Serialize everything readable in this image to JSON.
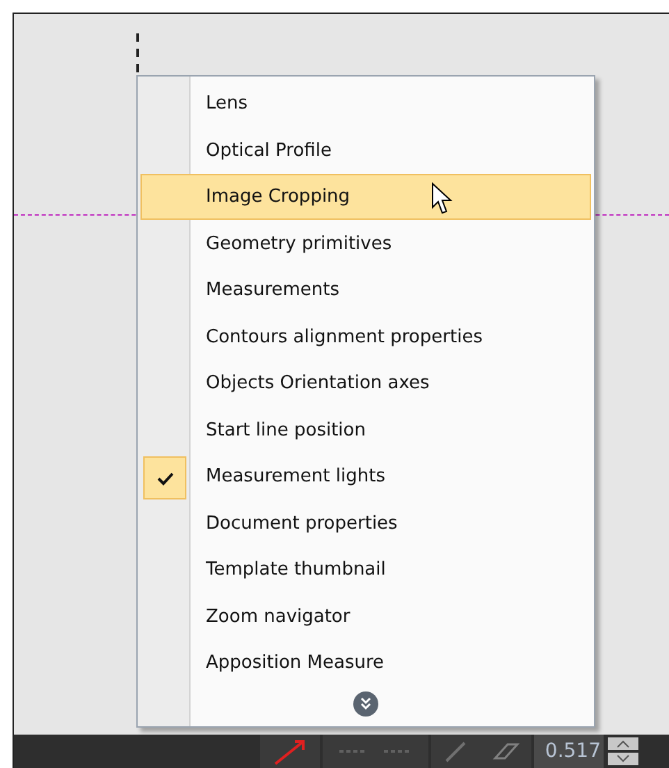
{
  "menu": {
    "items": [
      {
        "label": "Lens",
        "checked": false,
        "selected": false
      },
      {
        "label": "Optical Profile",
        "checked": false,
        "selected": false
      },
      {
        "label": "Image Cropping",
        "checked": false,
        "selected": true
      },
      {
        "label": "Geometry primitives",
        "checked": false,
        "selected": false
      },
      {
        "label": "Measurements",
        "checked": false,
        "selected": false
      },
      {
        "label": "Contours alignment properties",
        "checked": false,
        "selected": false
      },
      {
        "label": "Objects Orientation axes",
        "checked": false,
        "selected": false
      },
      {
        "label": "Start line position",
        "checked": false,
        "selected": false
      },
      {
        "label": "Measurement lights",
        "checked": true,
        "selected": false
      },
      {
        "label": "Document properties",
        "checked": false,
        "selected": false
      },
      {
        "label": "Template thumbnail",
        "checked": false,
        "selected": false
      },
      {
        "label": "Zoom navigator",
        "checked": false,
        "selected": false
      },
      {
        "label": "Apposition Measure",
        "checked": false,
        "selected": false
      }
    ]
  },
  "toolbar": {
    "value": "0.517"
  }
}
